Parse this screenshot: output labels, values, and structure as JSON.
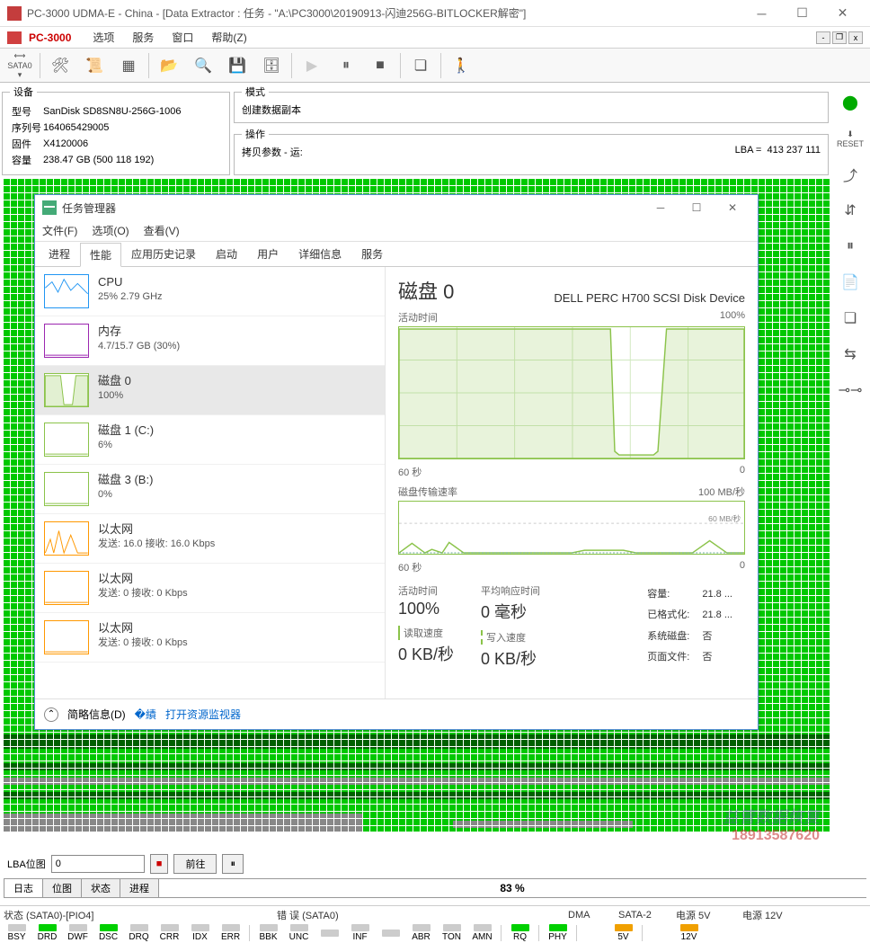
{
  "outerWindow": {
    "title": "PC-3000 UDMA-E - China - [Data Extractor : 任务 - \"A:\\PC3000\\20190913-闪迪256G-BITLOCKER解密\"]"
  },
  "menubar": {
    "appName": "PC-3000",
    "items": [
      "选项",
      "服务",
      "窗口",
      "帮助(Z)"
    ]
  },
  "toolbar": {
    "sataLabel": "SATA0"
  },
  "deviceInfo": {
    "legend": "设备",
    "modelLabel": "型号",
    "model": "SanDisk SD8SN8U-256G-1006",
    "serialLabel": "序列号",
    "serial": "164065429005",
    "firmwareLabel": "固件",
    "firmware": "X4120006",
    "capacityLabel": "容量",
    "capacity": "238.47 GB (500 118 192)"
  },
  "modeInfo": {
    "legend": "模式",
    "value": "创建数据副本"
  },
  "operationInfo": {
    "legend": "操作",
    "label": "拷贝参数 - 运:",
    "lbaLabel": "LBA =",
    "lbaValue": "413 237 111"
  },
  "taskManager": {
    "title": "任务管理器",
    "menu": [
      "文件(F)",
      "选项(O)",
      "查看(V)"
    ],
    "tabs": [
      "进程",
      "性能",
      "应用历史记录",
      "启动",
      "用户",
      "详细信息",
      "服务"
    ],
    "activeTab": 1,
    "leftItems": [
      {
        "name": "CPU",
        "sub": "25% 2.79 GHz",
        "color": "#2196f3"
      },
      {
        "name": "内存",
        "sub": "4.7/15.7 GB (30%)",
        "color": "#9c27b0"
      },
      {
        "name": "磁盘 0",
        "sub": "100%",
        "color": "#8bc34a",
        "selected": true
      },
      {
        "name": "磁盘 1 (C:)",
        "sub": "6%",
        "color": "#8bc34a"
      },
      {
        "name": "磁盘 3 (B:)",
        "sub": "0%",
        "color": "#8bc34a"
      },
      {
        "name": "以太网",
        "sub": "发送: 16.0 接收: 16.0 Kbps",
        "color": "#ff9800"
      },
      {
        "name": "以太网",
        "sub": "发送: 0 接收: 0 Kbps",
        "color": "#ff9800"
      },
      {
        "name": "以太网",
        "sub": "发送: 0 接收: 0 Kbps",
        "color": "#ff9800"
      }
    ],
    "right": {
      "heading": "磁盘 0",
      "device": "DELL PERC H700 SCSI Disk Device",
      "chart1Label": "活动时间",
      "chart1Max": "100%",
      "chart1XLabel": "60 秒",
      "chart1XRight": "0",
      "chart2Label": "磁盘传输速率",
      "chart2Max": "100 MB/秒",
      "chart2Mid": "60 MB/秒",
      "chart2XLabel": "60 秒",
      "stats": {
        "activeTimeLabel": "活动时间",
        "activeTime": "100%",
        "avgRespLabel": "平均响应时间",
        "avgResp": "0 毫秒",
        "readLabel": "读取速度",
        "read": "0 KB/秒",
        "writeLabel": "写入速度",
        "write": "0 KB/秒"
      },
      "props": {
        "capacityLabel": "容量:",
        "capacity": "21.8 ...",
        "formattedLabel": "已格式化:",
        "formatted": "21.8 ...",
        "sysDiskLabel": "系统磁盘:",
        "sysDisk": "否",
        "pageFileLabel": "页面文件:",
        "pageFile": "否"
      }
    },
    "footer": {
      "brief": "简略信息(D)",
      "resmon": "打开资源监视器"
    }
  },
  "bottomControls": {
    "lbaMapLabel": "LBA位图",
    "lbaValue": "0",
    "gotoLabel": "前往"
  },
  "bottomTabs": {
    "tabs": [
      "日志",
      "位图",
      "状态",
      "进程"
    ],
    "progress": "83 %"
  },
  "statusRow": {
    "status": "状态 (SATA0)-[PIO4]",
    "errors": "错 误 (SATA0)",
    "dma": "DMA",
    "sata2": "SATA-2",
    "power5": "电源 5V",
    "power12": "电源 12V"
  },
  "leds": {
    "status": [
      {
        "name": "BSY",
        "on": false
      },
      {
        "name": "DRD",
        "on": true
      },
      {
        "name": "DWF",
        "on": false
      },
      {
        "name": "DSC",
        "on": true
      },
      {
        "name": "DRQ",
        "on": false
      },
      {
        "name": "CRR",
        "on": false
      },
      {
        "name": "IDX",
        "on": false
      },
      {
        "name": "ERR",
        "on": false
      }
    ],
    "errors": [
      {
        "name": "BBK",
        "on": false
      },
      {
        "name": "UNC",
        "on": false
      },
      {
        "name": "",
        "on": false
      },
      {
        "name": "INF",
        "on": false
      },
      {
        "name": "",
        "on": false
      },
      {
        "name": "ABR",
        "on": false
      },
      {
        "name": "TON",
        "on": false
      },
      {
        "name": "AMN",
        "on": false
      }
    ],
    "dma": [
      {
        "name": "RQ",
        "on": true
      }
    ],
    "sata2": [
      {
        "name": "PHY",
        "on": true
      }
    ],
    "p5": [
      {
        "name": "5V",
        "on": true,
        "color": "orange"
      }
    ],
    "p12": [
      {
        "name": "12V",
        "on": true,
        "color": "orange"
      }
    ]
  },
  "watermark": {
    "line1": "益管数据恢复",
    "line2": "18913587620"
  },
  "chart_data": {
    "type": "line",
    "title": "磁盘 0 活动时间",
    "xlabel": "秒",
    "ylabel": "%",
    "xlim": [
      0,
      60
    ],
    "ylim": [
      0,
      100
    ],
    "series": [
      {
        "name": "活动时间",
        "values_approx": "100% flat, drops to ~0% between ~18s-8s ago, returns to 100%"
      }
    ]
  }
}
